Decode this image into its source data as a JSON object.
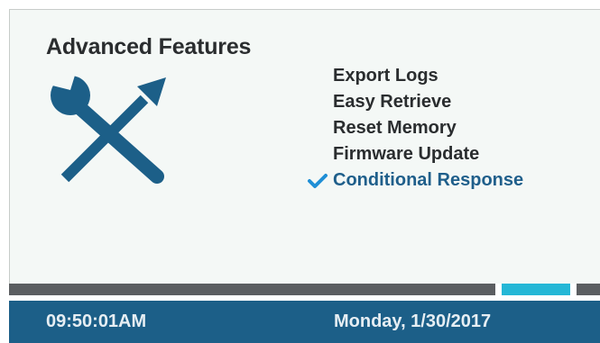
{
  "screen": {
    "title": "Advanced Features",
    "icon": "wrench-and-screwdriver-icon"
  },
  "menu": {
    "items": [
      {
        "label": "Export Logs",
        "selected": false
      },
      {
        "label": "Easy Retrieve",
        "selected": false
      },
      {
        "label": "Reset Memory",
        "selected": false
      },
      {
        "label": "Firmware Update",
        "selected": false
      },
      {
        "label": "Conditional Response",
        "selected": true
      }
    ],
    "check_icon": "checkmark-icon"
  },
  "status": {
    "time": "09:50:01AM",
    "date": "Monday, 1/30/2017"
  },
  "colors": {
    "accent": "#24b7d6",
    "brand_blue": "#1c5f88",
    "selected_text": "#1f5f8b",
    "dark_bar": "#5b5e61",
    "panel_bg": "#f4f8f6"
  }
}
